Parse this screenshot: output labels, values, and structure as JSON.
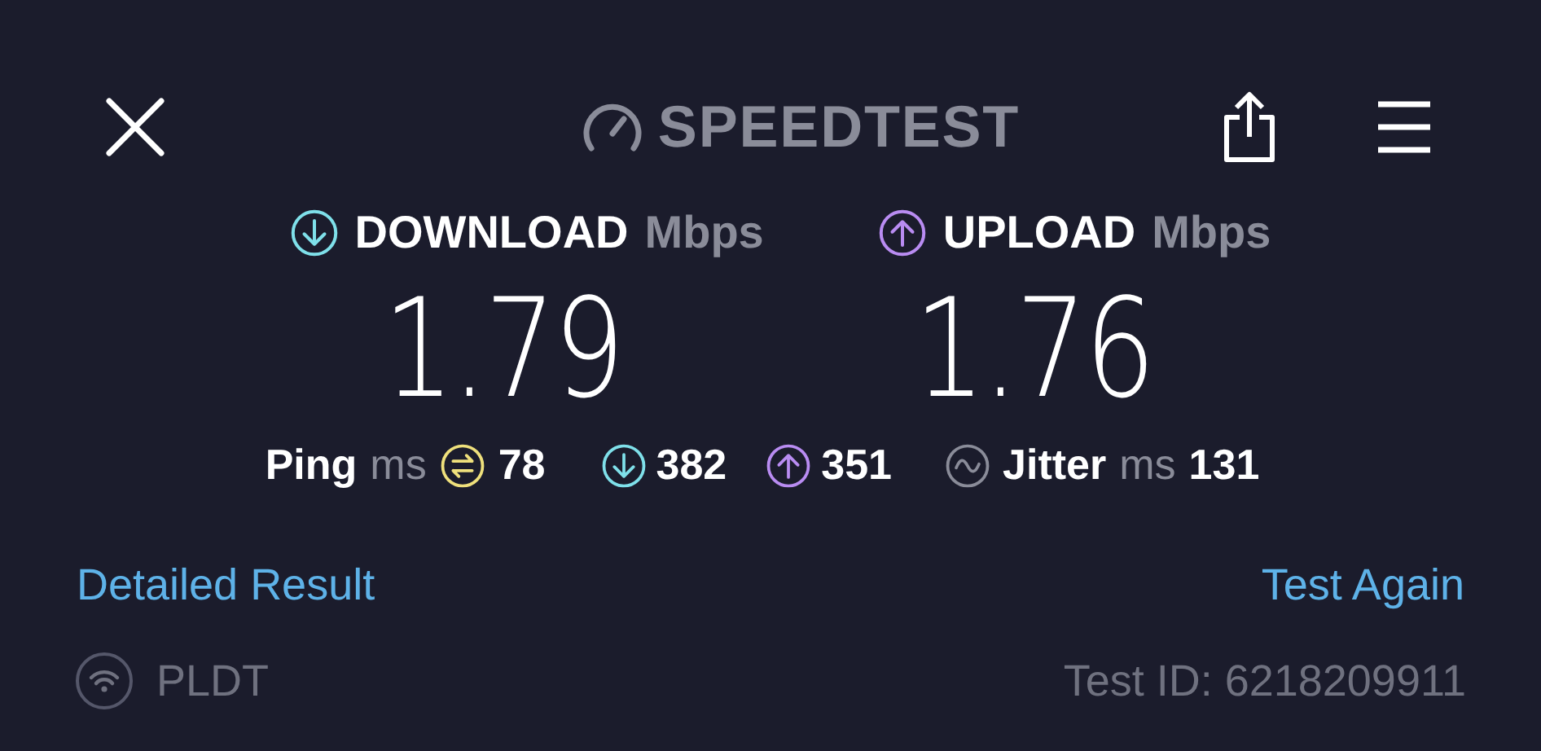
{
  "header": {
    "title": "SPEEDTEST"
  },
  "metrics": [
    {
      "kind": "download",
      "label": "DOWNLOAD",
      "unit": "Mbps",
      "value": "1.79"
    },
    {
      "kind": "upload",
      "label": "UPLOAD",
      "unit": "Mbps",
      "value": "1.76"
    }
  ],
  "latency": {
    "ping_label": "Ping",
    "ping_unit": "ms",
    "ping_value": "78",
    "download_value": "382",
    "upload_value": "351",
    "jitter_label": "Jitter",
    "jitter_unit": "ms",
    "jitter_value": "131"
  },
  "links": {
    "detailed": "Detailed Result",
    "again": "Test Again"
  },
  "footer": {
    "provider": "PLDT",
    "test_id": "Test ID: 6218209911"
  }
}
